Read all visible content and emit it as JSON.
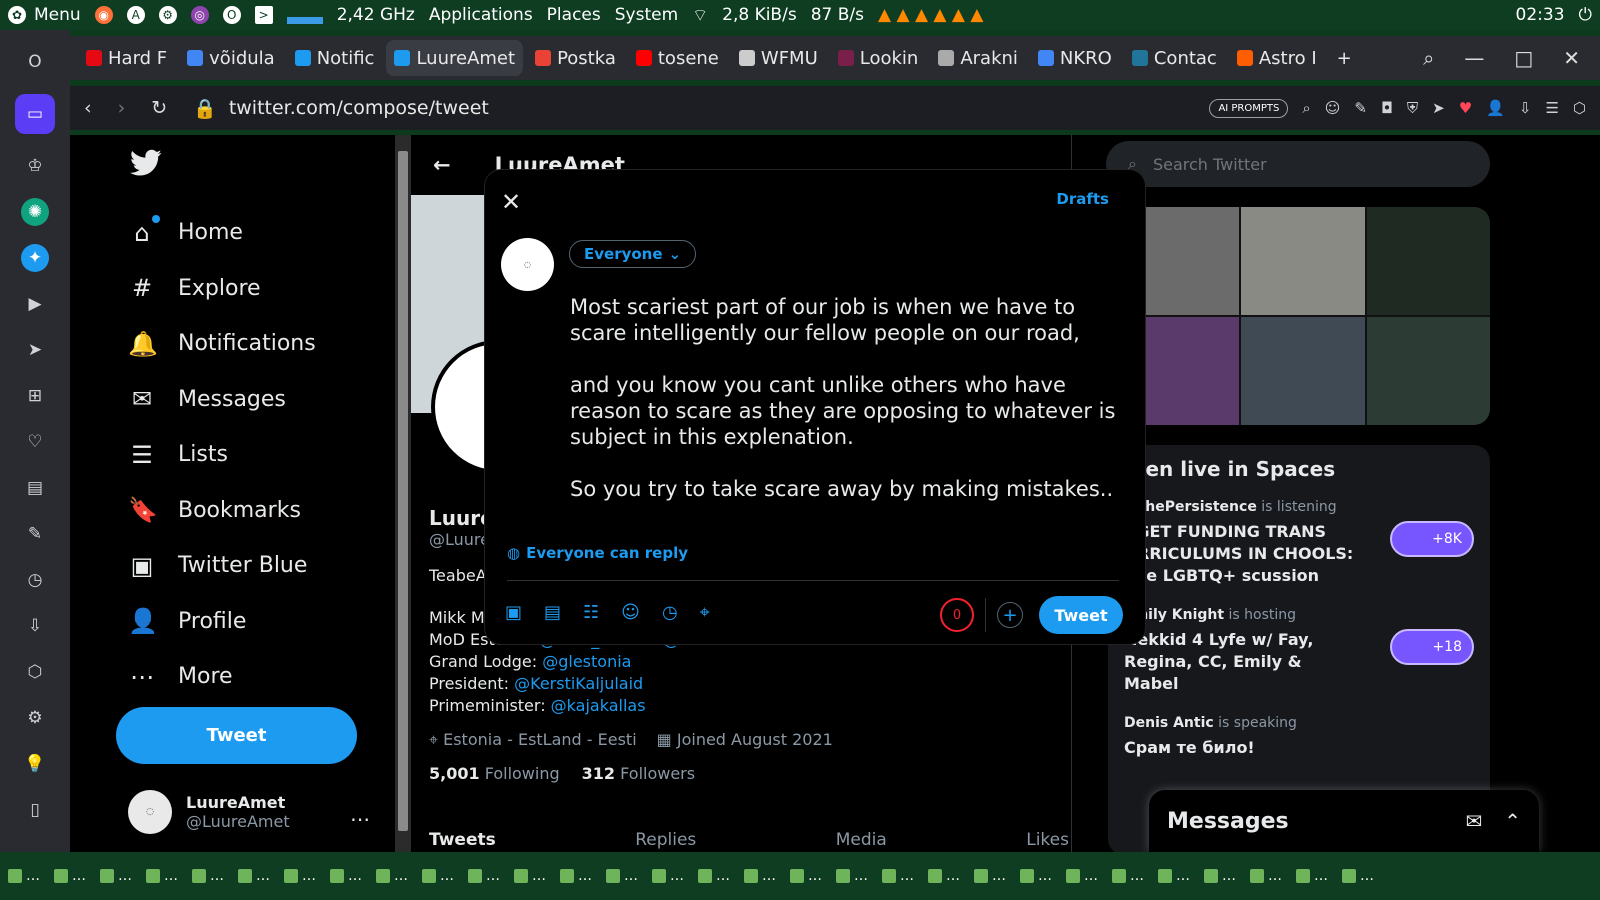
{
  "system_bar": {
    "menu": "Menu",
    "cpu_freq": "2,42 GHz",
    "applications": "Applications",
    "places": "Places",
    "system": "System",
    "net_down": "2,8 KiB/s",
    "net_up": "87 B/s",
    "clock": "02:33"
  },
  "tabs": [
    {
      "label": "Hard F",
      "color": "#e50914"
    },
    {
      "label": "võidula",
      "color": "#4285f4"
    },
    {
      "label": "Notific",
      "color": "#1d9bf0"
    },
    {
      "label": "LuureAmet",
      "color": "#1d9bf0",
      "selected": true
    },
    {
      "label": "Postka",
      "color": "#ea4335"
    },
    {
      "label": "tosene",
      "color": "#ff0000"
    },
    {
      "label": "WFMU",
      "color": "#cccccc"
    },
    {
      "label": "Lookin",
      "color": "#7a1f4a"
    },
    {
      "label": "Arakni",
      "color": "#aaaaaa"
    },
    {
      "label": "NKRO",
      "color": "#4285f4"
    },
    {
      "label": "Contac",
      "color": "#21759b"
    },
    {
      "label": "Astro I",
      "color": "#ff5d01"
    }
  ],
  "address": {
    "url": "twitter.com/compose/tweet",
    "ai_prompts": "AI PROMPTS"
  },
  "nav": {
    "items": [
      {
        "label": "Home",
        "icon": "⌂"
      },
      {
        "label": "Explore",
        "icon": "#"
      },
      {
        "label": "Notifications",
        "icon": "🔔"
      },
      {
        "label": "Messages",
        "icon": "✉"
      },
      {
        "label": "Lists",
        "icon": "☰"
      },
      {
        "label": "Bookmarks",
        "icon": "🔖"
      },
      {
        "label": "Twitter Blue",
        "icon": "▣"
      },
      {
        "label": "Profile",
        "icon": "👤"
      },
      {
        "label": "More",
        "icon": "⋯"
      }
    ],
    "tweet_button": "Tweet",
    "account_name": "LuureAmet",
    "account_handle": "@LuureAmet"
  },
  "profile": {
    "header_name": "LuureAmet",
    "name_partial": "Luure",
    "handle_partial": "@Luure",
    "bio_line1": "TeabeA",
    "bio_line2": "Mikk M",
    "mod_label": "MoD Estonia:",
    "mod_links": "@MoD_Estonia @kaitsemin",
    "lodge_label": "Grand Lodge:",
    "lodge_link": "@glestonia",
    "president_label": "President:",
    "president_link": "@KerstiKaljulaid",
    "pm_label": "Primeminister:",
    "pm_link": "@kajakallas",
    "location": "Estonia - EstLand - Eesti",
    "joined": "Joined August 2021",
    "following_count": "5,001",
    "following_label": "Following",
    "followers_count": "312",
    "followers_label": "Followers",
    "tabs": [
      "Tweets",
      "Replies",
      "Media",
      "Likes"
    ]
  },
  "right": {
    "search_placeholder": "Search Twitter",
    "spaces_title": "sten live in Spaces",
    "spaces": [
      {
        "host": "#ThePersistence",
        "status": "is listening",
        "title": "RGET FUNDING TRANS URRICULUMS IN CHOOLS: The LGBTQ+ scussion",
        "count": "+8K"
      },
      {
        "host": "Emily Knight",
        "status": "is hosting",
        "title": "Nekkid 4 Lyfe w/ Fay, Regina, CC, Emily & Mabel",
        "count": "+18"
      },
      {
        "host": "Denis Antic",
        "status": "is speaking",
        "title": "Срам те било!",
        "count": ""
      }
    ]
  },
  "messages_drawer": {
    "title": "Messages"
  },
  "composer": {
    "drafts": "Drafts",
    "audience": "Everyone",
    "text": "Most scariest part of our job is when we have to scare intelligently our fellow people on our road,\n\nand you know you cant unlike others who have reason to scare as they are opposing to whatever is subject in this explenation.\n\nSo you try to take scare away by making mistakes..",
    "reply_setting": "Everyone can reply",
    "char_count": "0",
    "tweet_button": "Tweet"
  }
}
